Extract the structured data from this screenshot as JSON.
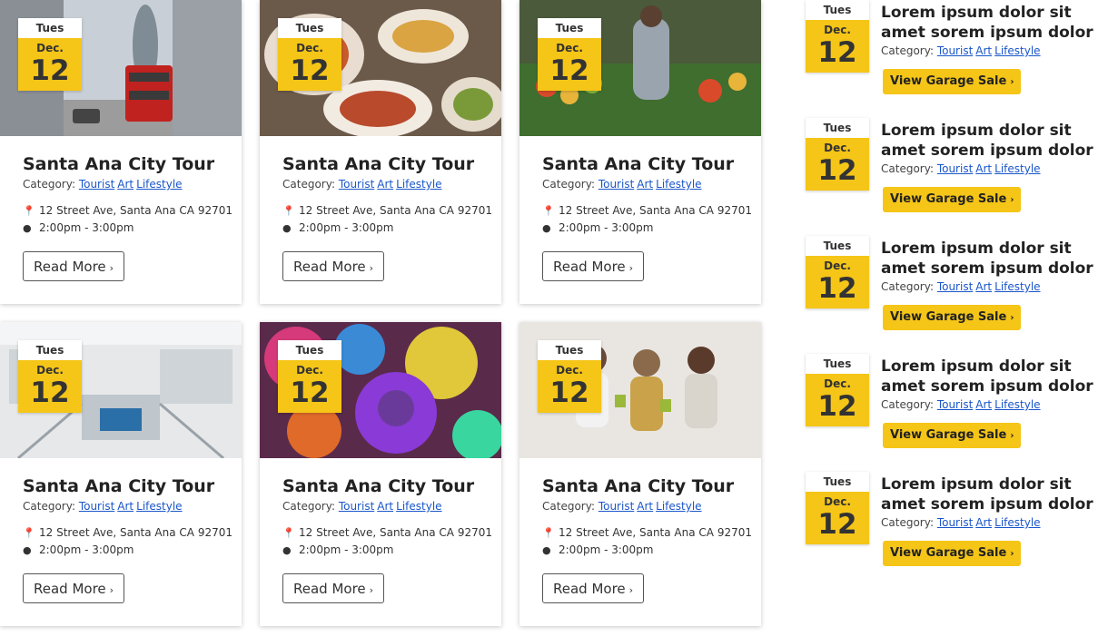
{
  "labels": {
    "category": "Category:",
    "read_more": "Read More",
    "view_sale": "View Garage Sale",
    "chevron": "›"
  },
  "colors": {
    "accent": "#f5c518",
    "link": "#1a56c9"
  },
  "cards": [
    {
      "dow": "Tues",
      "month": "Dec.",
      "day": "12",
      "title": "Santa Ana City Tour",
      "tags": [
        "Tourist",
        "Art",
        "Lifestyle"
      ],
      "address": "12 Street Ave, Santa Ana CA 92701",
      "time": "2:00pm - 3:00pm",
      "image": "city-street-bus-photo"
    },
    {
      "dow": "Tues",
      "month": "Dec.",
      "day": "12",
      "title": "Santa Ana City Tour",
      "tags": [
        "Tourist",
        "Art",
        "Lifestyle"
      ],
      "address": "12 Street Ave, Santa Ana CA 92701",
      "time": "2:00pm - 3:00pm",
      "image": "food-platter-photo"
    },
    {
      "dow": "Tues",
      "month": "Dec.",
      "day": "12",
      "title": "Santa Ana City Tour",
      "tags": [
        "Tourist",
        "Art",
        "Lifestyle"
      ],
      "address": "12 Street Ave, Santa Ana CA 92701",
      "time": "2:00pm - 3:00pm",
      "image": "market-stall-photo"
    },
    {
      "dow": "Tues",
      "month": "Dec.",
      "day": "12",
      "title": "Santa Ana City Tour",
      "tags": [
        "Tourist",
        "Art",
        "Lifestyle"
      ],
      "address": "12 Street Ave, Santa Ana CA 92701",
      "time": "2:00pm - 3:00pm",
      "image": "library-interior-photo"
    },
    {
      "dow": "Tues",
      "month": "Dec.",
      "day": "12",
      "title": "Santa Ana City Tour",
      "tags": [
        "Tourist",
        "Art",
        "Lifestyle"
      ],
      "address": "12 Street Ave, Santa Ana CA 92701",
      "time": "2:00pm - 3:00pm",
      "image": "color-festival-photo"
    },
    {
      "dow": "Tues",
      "month": "Dec.",
      "day": "12",
      "title": "Santa Ana City Tour",
      "tags": [
        "Tourist",
        "Art",
        "Lifestyle"
      ],
      "address": "12 Street Ave, Santa Ana CA 92701",
      "time": "2:00pm - 3:00pm",
      "image": "women-meeting-photo"
    }
  ],
  "sidebar": [
    {
      "dow": "Tues",
      "month": "Dec.",
      "day": "12",
      "title": "Lorem ipsum dolor sit amet sorem ipsum dolor",
      "tags": [
        "Tourist",
        "Art",
        "Lifestyle"
      ]
    },
    {
      "dow": "Tues",
      "month": "Dec.",
      "day": "12",
      "title": "Lorem ipsum dolor sit amet sorem ipsum dolor",
      "tags": [
        "Tourist",
        "Art",
        "Lifestyle"
      ]
    },
    {
      "dow": "Tues",
      "month": "Dec.",
      "day": "12",
      "title": "Lorem ipsum dolor sit amet sorem ipsum dolor",
      "tags": [
        "Tourist",
        "Art",
        "Lifestyle"
      ]
    },
    {
      "dow": "Tues",
      "month": "Dec.",
      "day": "12",
      "title": "Lorem ipsum dolor sit amet sorem ipsum dolor",
      "tags": [
        "Tourist",
        "Art",
        "Lifestyle"
      ]
    },
    {
      "dow": "Tues",
      "month": "Dec.",
      "day": "12",
      "title": "Lorem ipsum dolor sit amet sorem ipsum dolor",
      "tags": [
        "Tourist",
        "Art",
        "Lifestyle"
      ]
    }
  ]
}
